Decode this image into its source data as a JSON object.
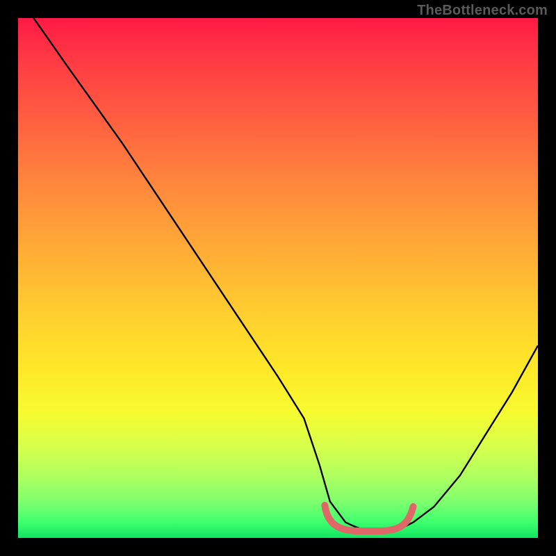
{
  "watermark": "TheBottleneck.com",
  "colors": {
    "background": "#000000",
    "curve_stroke": "#000000",
    "marker_stroke": "#e06767",
    "gradient_top": "#ff1a46",
    "gradient_bottom": "#10e560"
  },
  "chart_data": {
    "type": "line",
    "title": "",
    "xlabel": "",
    "ylabel": "",
    "xlim": [
      0,
      100
    ],
    "ylim": [
      0,
      100
    ],
    "grid": false,
    "note": "V-shaped bottleneck curve; leftmost y-value is clipped at top of plot. Values estimated from pixel positions since no tick labels are present.",
    "series": [
      {
        "name": "bottleneck_curve",
        "x": [
          3,
          10,
          20,
          30,
          40,
          50,
          55,
          58,
          60,
          63,
          67,
          70,
          73,
          76,
          80,
          85,
          90,
          95,
          100
        ],
        "y": [
          100,
          90,
          76,
          61,
          46,
          31,
          23,
          14,
          7,
          3,
          1,
          1,
          1.5,
          3,
          6,
          12,
          20,
          28,
          37
        ]
      }
    ],
    "annotations": [
      {
        "name": "optimal_range",
        "shape": "bracket",
        "x_start": 59,
        "x_end": 76,
        "y": 3,
        "description": "Pink U-shaped marker at valley indicating optimal/no-bottleneck range"
      }
    ]
  }
}
